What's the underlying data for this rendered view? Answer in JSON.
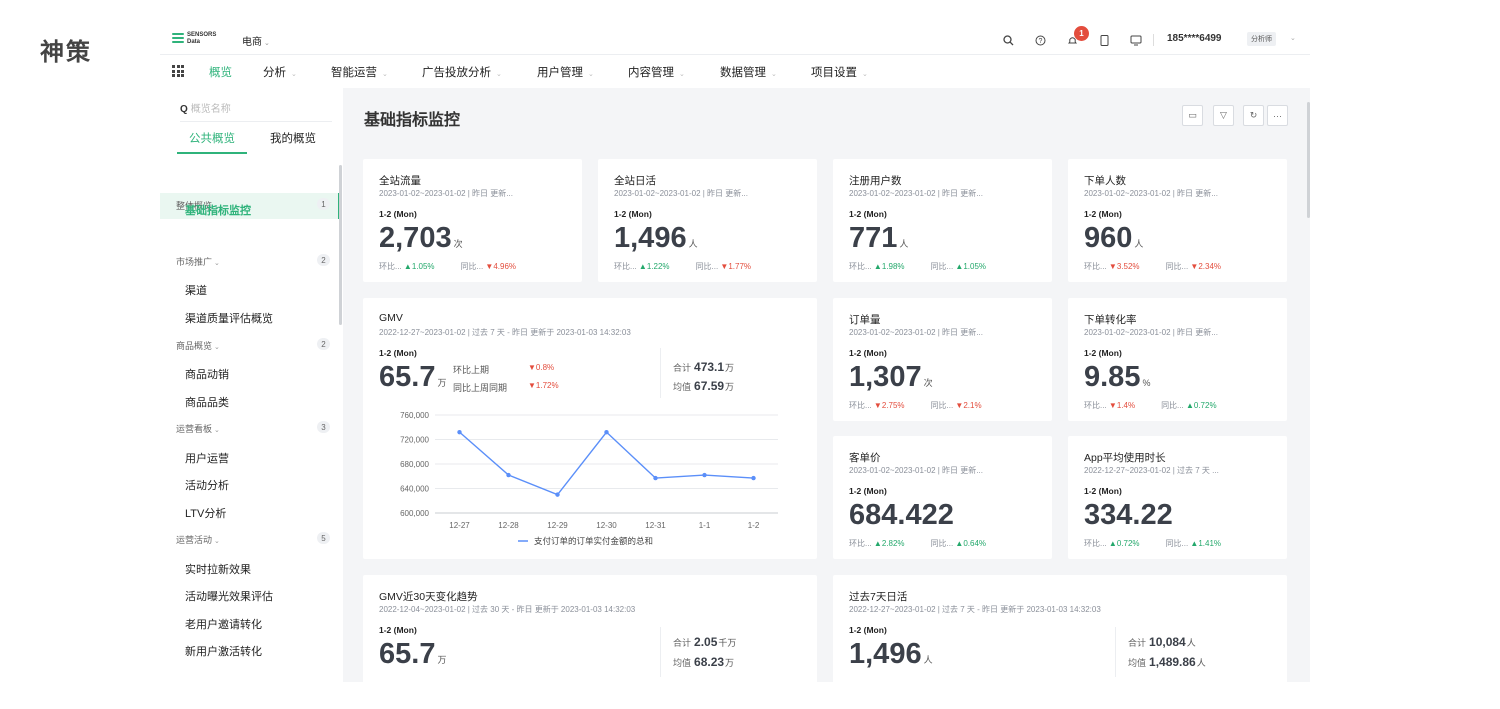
{
  "brand_title": "神策",
  "logo": {
    "line1": "SENSORS",
    "line2": "Data"
  },
  "project": {
    "name": "电商"
  },
  "topbar": {
    "notification_count": "1",
    "user": "185****6499",
    "role": "分析师"
  },
  "nav": {
    "items": [
      "概览",
      "分析",
      "智能运营",
      "广告投放分析",
      "用户管理",
      "内容管理",
      "数据管理",
      "项目设置"
    ]
  },
  "sidebar": {
    "search_placeholder": "概览名称",
    "tabs": [
      "公共概览",
      "我的概览"
    ],
    "groups": [
      {
        "label": "整体概览",
        "count": "1",
        "items": [
          "基础指标监控"
        ]
      },
      {
        "label": "市场推广",
        "count": "2",
        "items": [
          "渠道",
          "渠道质量评估概览"
        ]
      },
      {
        "label": "商品概览",
        "count": "2",
        "items": [
          "商品动销",
          "商品品类"
        ]
      },
      {
        "label": "运营看板",
        "count": "3",
        "items": [
          "用户运营",
          "活动分析",
          "LTV分析"
        ]
      },
      {
        "label": "运营活动",
        "count": "5",
        "items": [
          "实时拉新效果",
          "活动曝光效果评估",
          "老用户邀请转化",
          "新用户激活转化"
        ]
      }
    ]
  },
  "main": {
    "title": "基础指标监控"
  },
  "cards": [
    {
      "title": "全站流量",
      "sub": "2023-01-02~2023-01-02 | 昨日 更新...",
      "date": "1-2 (Mon)",
      "value": "2,703",
      "unit": "次",
      "cmp1_label": "环比...",
      "cmp1": "▲1.05%",
      "cmp2_label": "同比...",
      "cmp2": "▼4.96%"
    },
    {
      "title": "全站日活",
      "sub": "2023-01-02~2023-01-02 | 昨日 更新...",
      "date": "1-2 (Mon)",
      "value": "1,496",
      "unit": "人",
      "cmp1_label": "环比...",
      "cmp1": "▲1.22%",
      "cmp2_label": "同比...",
      "cmp2": "▼1.77%"
    },
    {
      "title": "注册用户数",
      "sub": "2023-01-02~2023-01-02 | 昨日 更新...",
      "date": "1-2 (Mon)",
      "value": "771",
      "unit": "人",
      "cmp1_label": "环比...",
      "cmp1": "▲1.98%",
      "cmp2_label": "同比...",
      "cmp2": "▲1.05%"
    },
    {
      "title": "下单人数",
      "sub": "2023-01-02~2023-01-02 | 昨日 更新...",
      "date": "1-2 (Mon)",
      "value": "960",
      "unit": "人",
      "cmp1_label": "环比...",
      "cmp1": "▼3.52%",
      "cmp2_label": "同比...",
      "cmp2": "▼2.34%"
    },
    {
      "title": "订单量",
      "sub": "2023-01-02~2023-01-02 | 昨日 更新...",
      "date": "1-2 (Mon)",
      "value": "1,307",
      "unit": "次",
      "cmp1_label": "环比...",
      "cmp1": "▼2.75%",
      "cmp2_label": "同比...",
      "cmp2": "▼2.1%"
    },
    {
      "title": "下单转化率",
      "sub": "2023-01-02~2023-01-02 | 昨日 更新...",
      "date": "1-2 (Mon)",
      "value": "9.85",
      "unit": "%",
      "cmp1_label": "环比...",
      "cmp1": "▼1.4%",
      "cmp2_label": "同比...",
      "cmp2": "▲0.72%"
    },
    {
      "title": "客单价",
      "sub": "2023-01-02~2023-01-02 | 昨日 更新...",
      "date": "1-2 (Mon)",
      "value": "684.422",
      "unit": "",
      "cmp1_label": "环比...",
      "cmp1": "▲2.82%",
      "cmp2_label": "同比...",
      "cmp2": "▲0.64%"
    },
    {
      "title": "App平均使用时长",
      "sub": "2022-12-27~2023-01-02 | 过去 7 天 ...",
      "date": "1-2 (Mon)",
      "value": "334.22",
      "unit": "",
      "cmp1_label": "环比...",
      "cmp1": "▲0.72%",
      "cmp2_label": "同比...",
      "cmp2": "▲1.41%"
    }
  ],
  "gmv": {
    "title": "GMV",
    "sub": "2022-12-27~2023-01-02 | 过去 7 天 - 昨日 更新于 2023-01-03 14:32:03",
    "date": "1-2 (Mon)",
    "value": "65.7",
    "unit": "万",
    "cmp1_label": "环比上期",
    "cmp1": "▼0.8%",
    "cmp2_label": "同比上周同期",
    "cmp2": "▼1.72%",
    "total_label": "合计",
    "total": "473.1",
    "total_unit": "万",
    "avg_label": "均值",
    "avg": "67.59",
    "avg_unit": "万"
  },
  "gmv30": {
    "title": "GMV近30天变化趋势",
    "sub": "2022-12-04~2023-01-02 | 过去 30 天 - 昨日 更新于 2023-01-03 14:32:03",
    "date": "1-2 (Mon)",
    "value": "65.7",
    "unit": "万",
    "total_label": "合计",
    "total": "2.05",
    "total_unit": "千万",
    "avg_label": "均值",
    "avg": "68.23",
    "avg_unit": "万"
  },
  "dau7": {
    "title": "过去7天日活",
    "sub": "2022-12-27~2023-01-02 | 过去 7 天 - 昨日 更新于 2023-01-03 14:32:03",
    "date": "1-2 (Mon)",
    "value": "1,496",
    "unit": "人",
    "total_label": "合计",
    "total": "10,084",
    "total_unit": "人",
    "avg_label": "均值",
    "avg": "1,489.86",
    "avg_unit": "人"
  },
  "colors": {
    "accent": "#2fb37b",
    "line": "#5b8ff9",
    "up": "#23a86b",
    "down": "#e34d3d"
  },
  "chart_data": {
    "type": "line",
    "categories": [
      "12-27",
      "12-28",
      "12-29",
      "12-30",
      "12-31",
      "1-1",
      "1-2"
    ],
    "series": [
      {
        "name": "支付订单的订单实付金额的总和",
        "values": [
          732000,
          662000,
          630000,
          732000,
          657000,
          662000,
          657000
        ]
      }
    ],
    "y_ticks": [
      "760,000",
      "720,000",
      "680,000",
      "640,000",
      "600,000"
    ],
    "ylim": [
      600000,
      760000
    ],
    "grid": true,
    "legend": "bottom"
  }
}
